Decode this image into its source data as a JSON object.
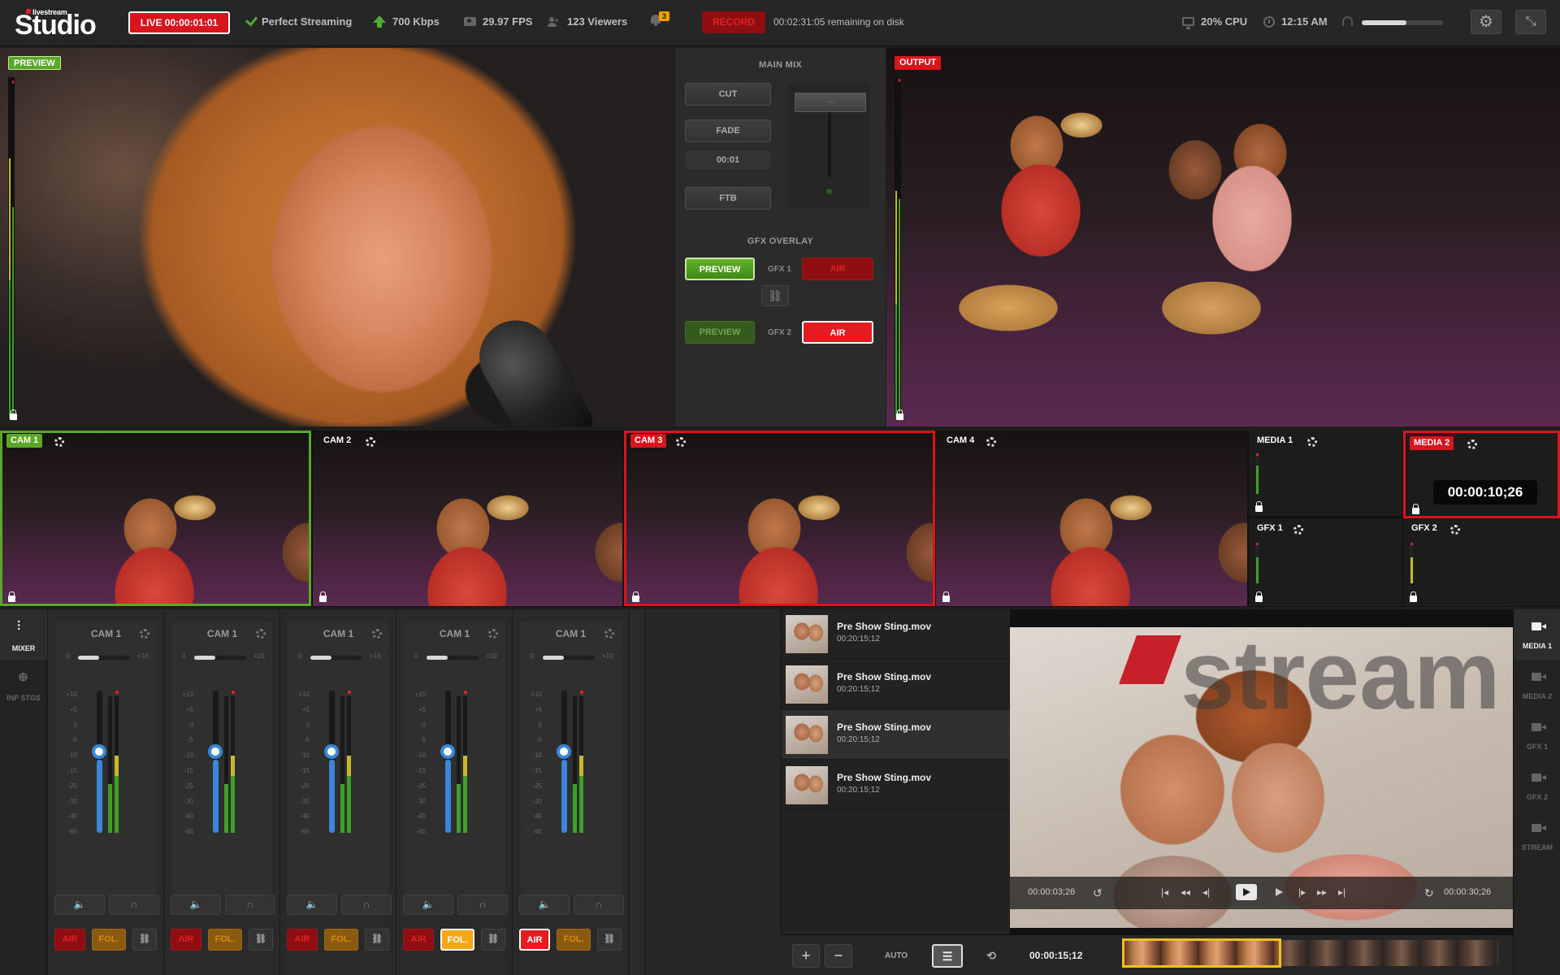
{
  "app": {
    "brand_small": "livestream",
    "brand_big": "Studio"
  },
  "topbar": {
    "live_label": "LIVE  00:00:01:01",
    "streaming_status": "Perfect Streaming",
    "bitrate": "700 Kbps",
    "fps": "29.97 FPS",
    "viewers": "123 Viewers",
    "notification_count": "3",
    "record_label": "RECORD",
    "disk_remaining": "00:02:31:05 remaining on disk",
    "cpu": "20% CPU",
    "time": "12:15 AM",
    "volume_level": 0.55,
    "settings_icon": "gear-icon",
    "collapse_icon": "collapse-icon"
  },
  "monitors": {
    "preview_label": "PREVIEW",
    "output_label": "OUTPUT"
  },
  "main_mix": {
    "title": "MAIN MIX",
    "cut_label": "CUT",
    "fade_label": "FADE",
    "duration": "00:01",
    "ftb_label": "FTB",
    "tbar_label": "...",
    "gfx_overlay_title": "GFX OVERLAY",
    "gfx1": {
      "preview_label": "PREVIEW",
      "name": "GFX 1",
      "air_label": "AIR"
    },
    "gfx2": {
      "preview_label": "PREVIEW",
      "name": "GFX 2",
      "air_label": "AIR"
    }
  },
  "sources": [
    {
      "label": "CAM 1",
      "state": "preview"
    },
    {
      "label": "CAM 2",
      "state": "idle"
    },
    {
      "label": "CAM 3",
      "state": "program"
    },
    {
      "label": "CAM 4",
      "state": "idle"
    }
  ],
  "media_sources": {
    "media1": "MEDIA 1",
    "media2": "MEDIA 2",
    "media2_time": "00:00:10;26",
    "gfx1": "GFX 1",
    "gfx2": "GFX 2"
  },
  "left_nav": [
    {
      "label": "MIXER",
      "active": true
    },
    {
      "label": "INP STGS",
      "active": false
    }
  ],
  "mixer": {
    "trim_min": "0",
    "trim_max": "+10",
    "fader_scale": [
      "+10",
      "+5",
      "0",
      "-5",
      "-10",
      "-15",
      "-25",
      "-30",
      "-40",
      "-60"
    ],
    "meter_scale": [
      "OVR",
      "0",
      "-2",
      "-4",
      "-6",
      "-10",
      "-12",
      "-14",
      "-24",
      "-36",
      "-48",
      "-72"
    ],
    "channels": [
      {
        "title": "CAM 1",
        "air_label": "AIR",
        "fol_label": "FOL.",
        "air_on": false,
        "fol_on": false
      },
      {
        "title": "CAM 1",
        "air_label": "AIR",
        "fol_label": "FOL.",
        "air_on": false,
        "fol_on": false
      },
      {
        "title": "CAM 1",
        "air_label": "AIR",
        "fol_label": "FOL.",
        "air_on": false,
        "fol_on": false
      },
      {
        "title": "CAM 1",
        "air_label": "AIR",
        "fol_label": "FOL.",
        "air_on": false,
        "fol_on": true
      },
      {
        "title": "CAM 1",
        "air_label": "AIR",
        "fol_label": "FOL.",
        "air_on": true,
        "fol_on": false
      }
    ]
  },
  "playlist": [
    {
      "name": "Pre Show Sting.mov",
      "duration": "00:20:15;12"
    },
    {
      "name": "Pre Show Sting.mov",
      "duration": "00:20:15;12"
    },
    {
      "name": "Pre Show Sting.mov",
      "duration": "00:20:15;12"
    },
    {
      "name": "Pre Show Sting.mov",
      "duration": "00:20:15;12"
    }
  ],
  "player": {
    "elapsed": "00:00:03;26",
    "remaining": "00:00:30;26",
    "watermark_text": "stream"
  },
  "right_nav": [
    {
      "label": "MEDIA 1",
      "active": true
    },
    {
      "label": "MEDIA 2",
      "active": false
    },
    {
      "label": "GFX 1",
      "active": false
    },
    {
      "label": "GFX 2",
      "active": false
    },
    {
      "label": "STREAM",
      "active": false
    }
  ],
  "bottombar": {
    "add": "+",
    "remove": "−",
    "auto_label": "AUTO",
    "position": "00:00:15;12"
  },
  "colors": {
    "live_red": "#d8141c",
    "preview_green": "#5aa828",
    "fol_amber": "#f4a818",
    "fader_blue": "#3a86d8"
  }
}
